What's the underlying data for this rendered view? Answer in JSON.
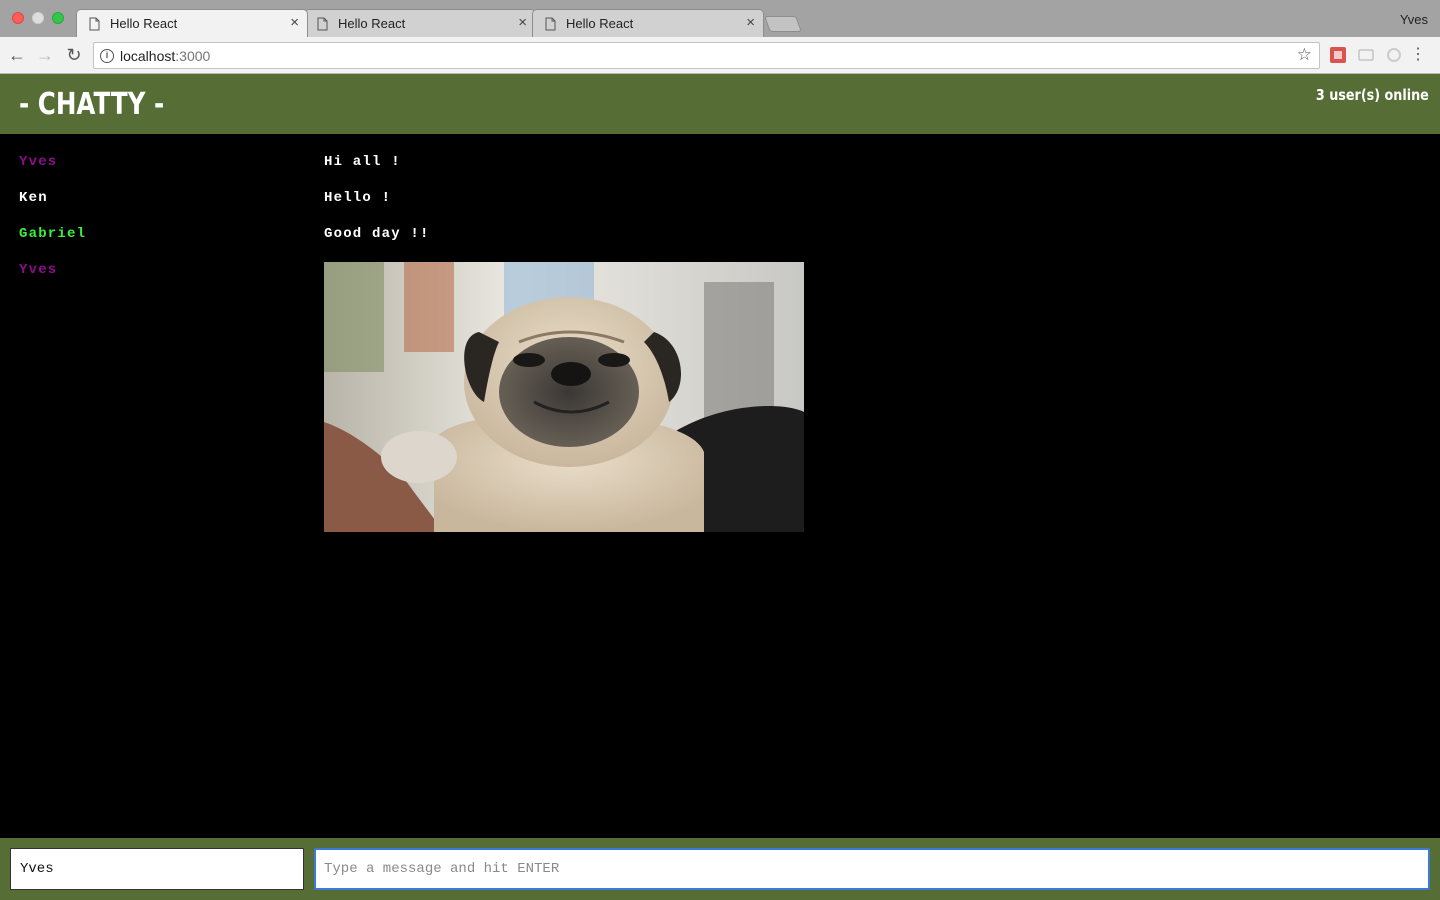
{
  "browser": {
    "tabs": [
      {
        "title": "Hello React",
        "active": true
      },
      {
        "title": "Hello React",
        "active": false
      },
      {
        "title": "Hello React",
        "active": false
      }
    ],
    "profile_name": "Yves",
    "url_host": "localhost",
    "url_port": ":3000"
  },
  "app": {
    "brand": "- CHATTY -",
    "online_count": "3 user(s) online"
  },
  "messages": [
    {
      "username": "Yves",
      "content": "Hi all !",
      "color": "#8b0d8b"
    },
    {
      "username": "Ken",
      "content": "Hello !",
      "color": "#ffffff"
    },
    {
      "username": "Gabriel",
      "content": "Good day !!",
      "color": "#3bf03b"
    },
    {
      "username": "Yves",
      "content": "",
      "color": "#8b0d8b"
    }
  ],
  "chatbar": {
    "username_value": "Yves",
    "message_placeholder": "Type a message and hit ENTER"
  },
  "colors": {
    "navbar": "#566d36",
    "background": "#000000",
    "input_focus": "#3b7ad9"
  }
}
